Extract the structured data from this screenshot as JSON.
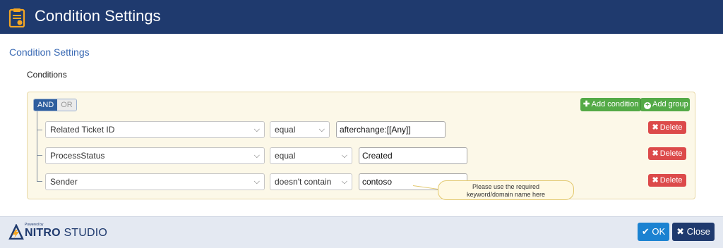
{
  "window": {
    "title": "Condition Settings",
    "icon": "clipboard-check-icon"
  },
  "section": {
    "title": "Condition Settings",
    "conditions_label": "Conditions"
  },
  "group": {
    "toggle": {
      "and_label": "AND",
      "or_label": "OR",
      "selected": "AND"
    },
    "add_condition_label": "Add condition",
    "add_group_label": "Add group"
  },
  "conditions": [
    {
      "field": "Related Ticket ID",
      "operator": "equal",
      "value": "afterchange:[[Any]]",
      "delete_label": "Delete"
    },
    {
      "field": "ProcessStatus",
      "operator": "equal",
      "value": "Created",
      "delete_label": "Delete"
    },
    {
      "field": "Sender",
      "operator": "doesn't contain",
      "value": "contoso",
      "delete_label": "Delete"
    }
  ],
  "callout": {
    "line1": "Please use the required",
    "line2": "keyword/domain name here"
  },
  "footer": {
    "logo": {
      "powered_by": "Powered by",
      "brand": "NITRO",
      "product": "STUDIO"
    },
    "ok_label": "OK",
    "close_label": "Close"
  },
  "colors": {
    "title_bar": "#1f3a6e",
    "section_title": "#3a6ab4",
    "add_button": "#54aa47",
    "delete_button": "#dc4a4a",
    "ok_button": "#1b82d1",
    "close_button": "#1f3a6e",
    "logo_accent": "#f5a623"
  }
}
